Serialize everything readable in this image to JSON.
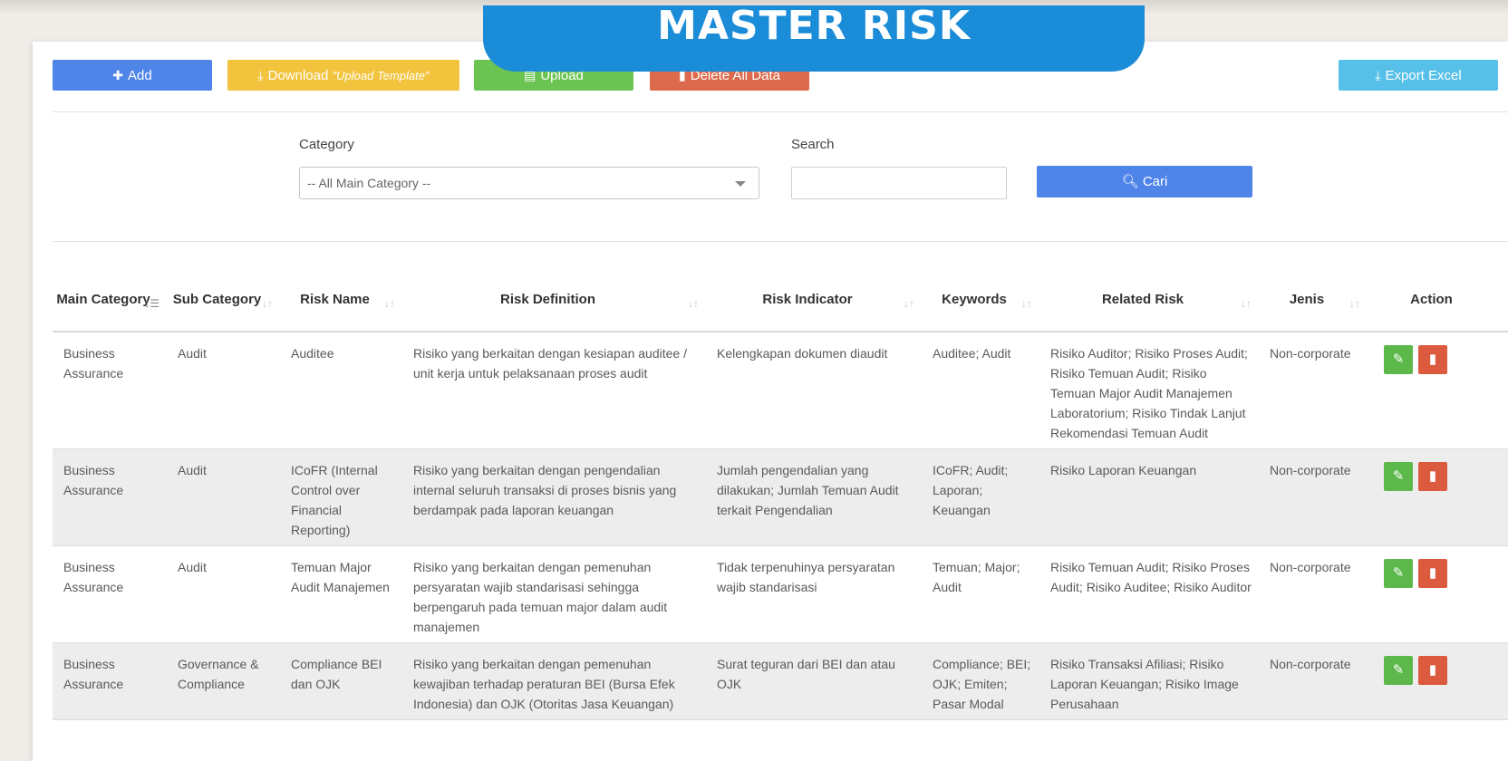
{
  "page": {
    "title": "MASTER RISK"
  },
  "toolbar": {
    "add_label": "Add",
    "download_label": "Download ",
    "download_em": "\"Upload Template\"",
    "upload_label": "Upload",
    "delete_all_label": "Delete All Data",
    "export_label": "Export Excel"
  },
  "filters": {
    "category_label": "Category",
    "category_selected": "-- All Main Category --",
    "search_label": "Search",
    "search_value": "",
    "search_button": "Cari"
  },
  "table": {
    "columns": [
      "Main Category",
      "Sub Category",
      "Risk Name",
      "Risk Definition",
      "Risk Indicator",
      "Keywords",
      "Related Risk",
      "Jenis",
      "Action"
    ],
    "rows": [
      {
        "main_category": "Business Assurance",
        "sub_category": "Audit",
        "risk_name": "Auditee",
        "risk_definition": "Risiko yang berkaitan dengan kesiapan auditee / unit kerja untuk pelaksanaan proses audit",
        "risk_indicator": "Kelengkapan dokumen diaudit",
        "keywords": "Auditee; Audit",
        "related_risk": "Risiko Auditor; Risiko Proses Audit; Risiko Temuan Audit; Risiko Temuan Major Audit Manajemen Laboratorium; Risiko Tindak Lanjut Rekomendasi Temuan Audit",
        "jenis": "Non-corporate"
      },
      {
        "main_category": "Business Assurance",
        "sub_category": "Audit",
        "risk_name": "ICoFR (Internal Control over Financial Reporting)",
        "risk_definition": "Risiko yang berkaitan dengan pengendalian internal seluruh transaksi di proses bisnis yang berdampak pada laporan keuangan",
        "risk_indicator": "Jumlah pengendalian yang dilakukan; Jumlah Temuan Audit terkait Pengendalian",
        "keywords": "ICoFR; Audit; Laporan; Keuangan",
        "related_risk": "Risiko Laporan Keuangan",
        "jenis": "Non-corporate"
      },
      {
        "main_category": "Business Assurance",
        "sub_category": "Audit",
        "risk_name": "Temuan Major Audit Manajemen",
        "risk_definition": "Risiko yang berkaitan dengan pemenuhan persyaratan wajib standarisasi sehingga berpengaruh pada temuan major dalam audit manajemen",
        "risk_indicator": "Tidak terpenuhinya persyaratan wajib standarisasi",
        "keywords": "Temuan; Major; Audit",
        "related_risk": "Risiko Temuan Audit; Risiko Proses Audit; Risiko Auditee; Risiko Auditor",
        "jenis": "Non-corporate"
      },
      {
        "main_category": "Business Assurance",
        "sub_category": "Governance & Compliance",
        "risk_name": "Compliance BEI dan OJK",
        "risk_definition": "Risiko yang berkaitan dengan pemenuhan kewajiban terhadap peraturan BEI (Bursa Efek Indonesia) dan OJK (Otoritas Jasa Keuangan)",
        "risk_indicator": "Surat teguran dari BEI dan atau OJK",
        "keywords": "Compliance; BEI; OJK; Emiten; Pasar Modal",
        "related_risk": "Risiko Transaksi Afiliasi; Risiko Laporan Keuangan; Risiko Image Perusahaan",
        "jenis": "Non-corporate"
      }
    ]
  },
  "icons": {
    "add": "plus-icon",
    "download": "download-icon",
    "upload": "file-upload-icon",
    "delete": "trash-icon",
    "export": "download-icon",
    "search": "search-icon",
    "edit": "pencil-icon",
    "sort": "sort-icon"
  },
  "colors": {
    "title_bg": "#1a8cd8",
    "primary": "#4f84e8",
    "warning": "#f2c43e",
    "success": "#6bc352",
    "danger": "#dd6a4d",
    "info": "#57c0e8"
  }
}
